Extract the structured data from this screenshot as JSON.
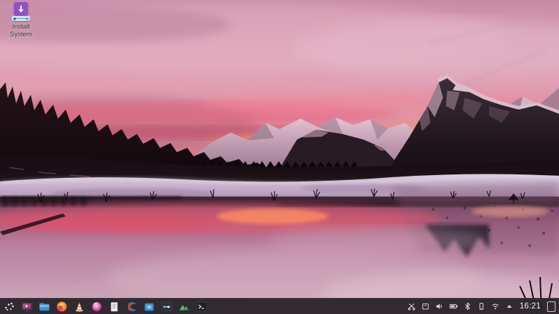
{
  "desktop": {
    "install_icon": {
      "line1": "Install",
      "line2": "System",
      "label": "Install System"
    }
  },
  "taskbar": {
    "clock": "16:21",
    "launcher_icons": [
      "app-launcher",
      "live-installer-display",
      "file-manager",
      "firefox-browser",
      "vlc-player",
      "media-disc",
      "document-viewer",
      "calligra-suite",
      "software-box",
      "settings-slider",
      "image-viewer",
      "terminal"
    ],
    "tray_icons": [
      "clipboard-manager",
      "device-notifier",
      "audio-volume",
      "battery",
      "bluetooth",
      "portable-device",
      "wifi-network",
      "expand-tray"
    ]
  },
  "colors": {
    "taskbar_bg": "#2a252c",
    "install_icon_purple": "#8e52c6",
    "sky_top": "#c88ba6",
    "sky_pink": "#e39aac",
    "horizon_orange": "#f2a057",
    "mountain_dark": "#241a21",
    "snow_band": "#c9b3cd",
    "water_red": "#e25a6d",
    "water_pink": "#c39bb0",
    "clock_text": "#f2eef4"
  }
}
